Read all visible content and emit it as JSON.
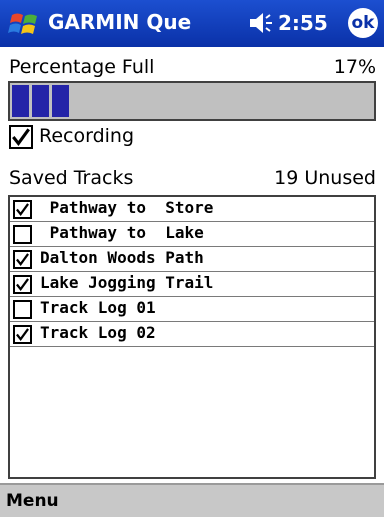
{
  "titlebar": {
    "app_title": "GARMIN Que",
    "time": "2:55",
    "ok_label": "ok",
    "start_icon": "windows-flag-icon",
    "volume_icon": "speaker-icon",
    "brand_color": "#0a31a8"
  },
  "storage": {
    "label": "Percentage Full",
    "value": "17%",
    "fill_percent": 17,
    "bar_color": "#2424a8"
  },
  "recording": {
    "label": "Recording",
    "checked": true
  },
  "saved": {
    "label": "Saved Tracks",
    "value": "19 Unused"
  },
  "tracks": [
    {
      "name": " Pathway to  Store",
      "checked": true
    },
    {
      "name": " Pathway to  Lake",
      "checked": false
    },
    {
      "name": "Dalton Woods Path",
      "checked": true
    },
    {
      "name": "Lake Jogging Trail",
      "checked": true
    },
    {
      "name": "Track Log 01",
      "checked": false
    },
    {
      "name": "Track Log 02",
      "checked": true
    }
  ],
  "menubar": {
    "menu_label": "Menu"
  }
}
